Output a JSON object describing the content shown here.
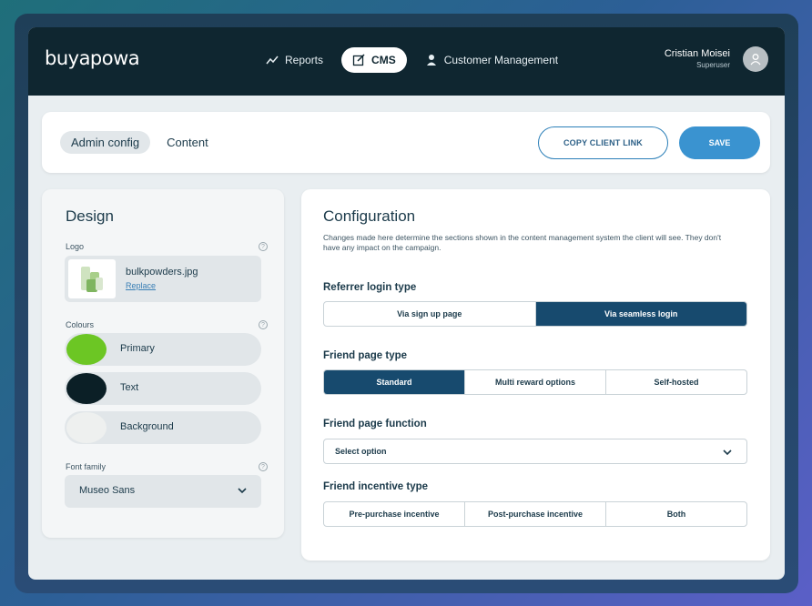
{
  "brand": "buyapowa",
  "nav": {
    "items": [
      {
        "label": "Reports",
        "icon": "chart-line-icon"
      },
      {
        "label": "CMS",
        "icon": "edit-icon",
        "active": true
      },
      {
        "label": "Customer Management",
        "icon": "person-icon"
      }
    ]
  },
  "user": {
    "name": "Cristian Moisei",
    "role": "Superuser",
    "icon": "user-avatar-icon"
  },
  "toolbar": {
    "tabs": [
      {
        "label": "Admin config",
        "active": true
      },
      {
        "label": "Content",
        "active": false
      }
    ],
    "copy_label": "COPY CLIENT LINK",
    "save_label": "SAVE"
  },
  "design": {
    "title": "Design",
    "logo_label": "Logo",
    "logo_file": "bulkpowders.jpg",
    "replace_label": "Replace",
    "colours_label": "Colours",
    "colours": [
      {
        "name": "Primary",
        "color": "#6cc624"
      },
      {
        "name": "Text",
        "color": "#0b1f26"
      },
      {
        "name": "Background",
        "color": "#eef0ef"
      }
    ],
    "font_label": "Font family",
    "font_value": "Museo Sans"
  },
  "config": {
    "title": "Configuration",
    "description": "Changes made here determine the sections shown in the content management system the client will see. They don't have any impact on the campaign.",
    "referrer_login": {
      "title": "Referrer login type",
      "options": [
        "Via sign up page",
        "Via seamless login"
      ],
      "selected": 1
    },
    "friend_page_type": {
      "title": "Friend page type",
      "options": [
        "Standard",
        "Multi reward options",
        "Self-hosted"
      ],
      "selected": 0
    },
    "friend_page_function": {
      "title": "Friend page function",
      "placeholder": "Select option"
    },
    "friend_incentive": {
      "title": "Friend incentive type",
      "options": [
        "Pre-purchase incentive",
        "Post-purchase incentive",
        "Both"
      ],
      "selected": -1
    }
  },
  "colors": {
    "topbar": "#0f2630",
    "accent": "#3a93d0",
    "selected": "#174a6e"
  }
}
